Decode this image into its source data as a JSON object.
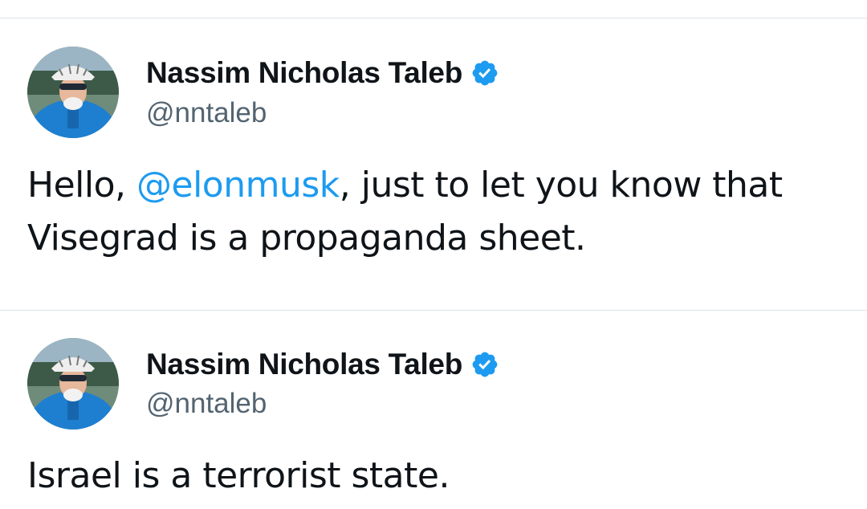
{
  "tweets": [
    {
      "author": {
        "display_name": "Nassim Nicholas Taleb",
        "handle": "@nntaleb",
        "verified": true
      },
      "text": {
        "before_mention": "Hello, ",
        "mention": "@elonmusk",
        "after_mention": ", just to let you know that Visegrad is a propaganda sheet."
      }
    },
    {
      "author": {
        "display_name": "Nassim Nicholas Taleb",
        "handle": "@nntaleb",
        "verified": true
      },
      "text": {
        "before_mention": "Israel is a terrorist state.",
        "mention": "",
        "after_mention": ""
      }
    }
  ],
  "colors": {
    "verified_badge": "#1d9bf0",
    "mention": "#1d9bf0",
    "handle": "#536471",
    "text": "#0f1419",
    "divider": "#dde3e7"
  },
  "icons": {
    "verified": "verified-badge-icon"
  }
}
